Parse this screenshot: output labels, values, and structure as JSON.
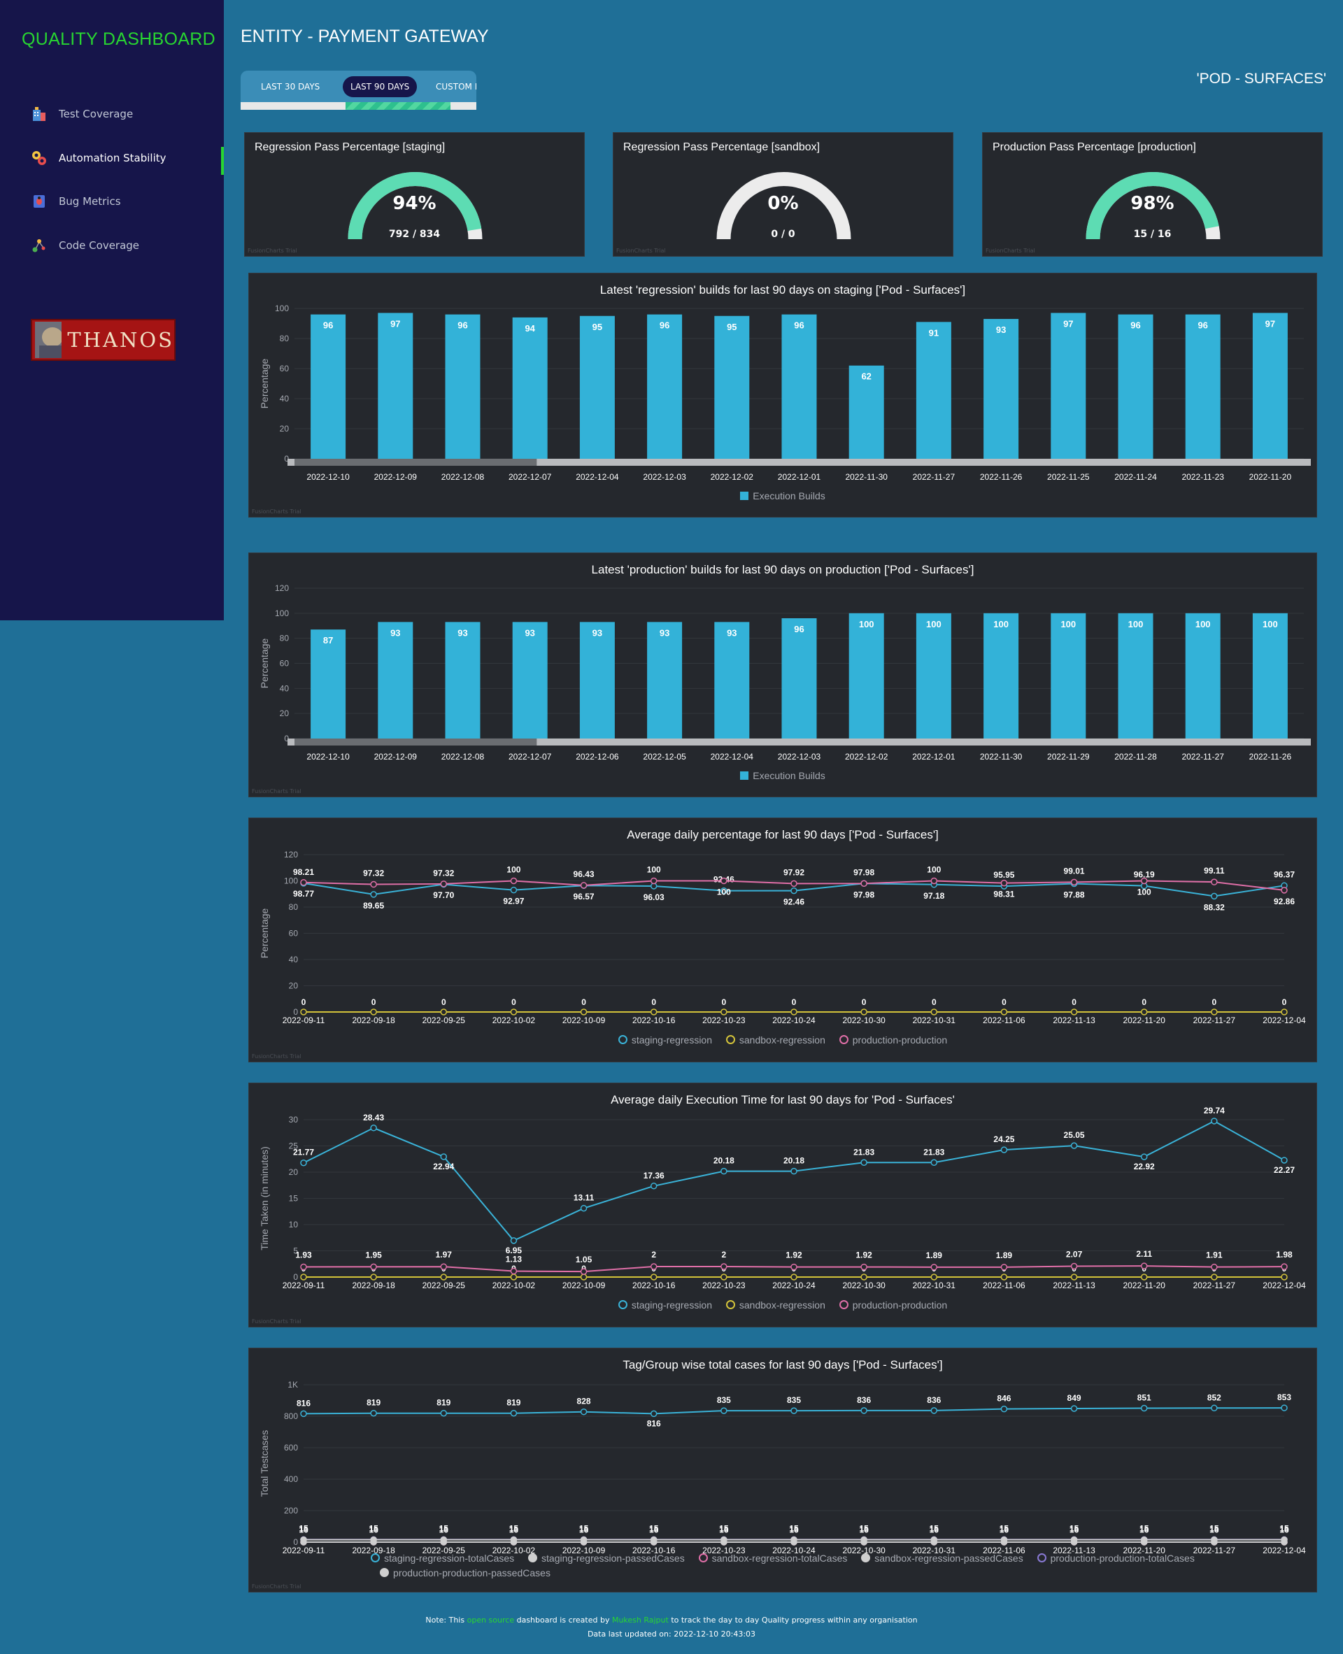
{
  "sidebar": {
    "app_title": "QUALITY DASHBOARD",
    "items": [
      {
        "label": "Test Coverage",
        "icon": "building-icon"
      },
      {
        "label": "Automation Stability",
        "icon": "gears-icon"
      },
      {
        "label": "Bug Metrics",
        "icon": "bug-icon"
      },
      {
        "label": "Code Coverage",
        "icon": "molecule-icon"
      }
    ],
    "active_index": 1,
    "logo_text": "THANOS"
  },
  "header": {
    "title": "ENTITY - PAYMENT GATEWAY",
    "pod_label": "'POD - SURFACES'",
    "tabs": [
      "LAST 30 DAYS",
      "LAST 90 DAYS",
      "CUSTOM DATE"
    ],
    "selected_tab": 1
  },
  "gauges": [
    {
      "title": "Regression Pass Percentage [staging]",
      "value": "94%",
      "sub": "792 / 834",
      "fraction": 0.9496,
      "trial": "FusionCharts Trial"
    },
    {
      "title": "Regression Pass Percentage [sandbox]",
      "value": "0%",
      "sub": "0 / 0",
      "fraction": 0,
      "trial": "FusionCharts Trial"
    },
    {
      "title": "Production Pass Percentage [production]",
      "value": "98%",
      "sub": "15 / 16",
      "fraction": 0.9375,
      "trial": "FusionCharts Trial"
    }
  ],
  "colors": {
    "bar": "#33b2d8",
    "staging": "#3ab3d8",
    "sandbox": "#d3c33a",
    "production": "#e06fa8",
    "gauge_fill": "#5ddcb3",
    "gauge_track": "#ececec",
    "green": "#28d631"
  },
  "chart_data": [
    {
      "type": "bar",
      "title": "Latest 'regression' builds for last 90 days on staging ['Pod - Surfaces']",
      "ylabel": "Percentage",
      "ylim": [
        0,
        100
      ],
      "yticks": [
        0,
        20,
        40,
        60,
        80,
        100
      ],
      "categories": [
        "2022-12-10",
        "2022-12-09",
        "2022-12-08",
        "2022-12-07",
        "2022-12-04",
        "2022-12-03",
        "2022-12-02",
        "2022-12-01",
        "2022-11-30",
        "2022-11-27",
        "2022-11-26",
        "2022-11-25",
        "2022-11-24",
        "2022-11-23",
        "2022-11-20"
      ],
      "series": [
        {
          "name": "Execution Builds",
          "values": [
            96,
            97,
            96,
            94,
            95,
            96,
            95,
            96,
            62,
            91,
            93,
            97,
            96,
            96,
            97
          ]
        }
      ],
      "trial": "FusionCharts Trial"
    },
    {
      "type": "bar",
      "title": "Latest 'production' builds for last 90 days on production ['Pod - Surfaces']",
      "ylabel": "Percentage",
      "ylim": [
        0,
        120
      ],
      "yticks": [
        0,
        20,
        40,
        60,
        80,
        100,
        120
      ],
      "categories": [
        "2022-12-10",
        "2022-12-09",
        "2022-12-08",
        "2022-12-07",
        "2022-12-06",
        "2022-12-05",
        "2022-12-04",
        "2022-12-03",
        "2022-12-02",
        "2022-12-01",
        "2022-11-30",
        "2022-11-29",
        "2022-11-28",
        "2022-11-27",
        "2022-11-26"
      ],
      "series": [
        {
          "name": "Execution Builds",
          "values": [
            87,
            93,
            93,
            93,
            93,
            93,
            93,
            96,
            100,
            100,
            100,
            100,
            100,
            100,
            100
          ]
        }
      ],
      "trial": "FusionCharts Trial"
    },
    {
      "type": "line",
      "title": "Average daily percentage for last 90 days ['Pod - Surfaces']",
      "ylabel": "Percentage",
      "ylim": [
        0,
        120
      ],
      "yticks": [
        0,
        20,
        40,
        60,
        80,
        100,
        120
      ],
      "categories": [
        "2022-09-11",
        "2022-09-18",
        "2022-09-25",
        "2022-10-02",
        "2022-10-09",
        "2022-10-16",
        "2022-10-23",
        "2022-10-24",
        "2022-10-30",
        "2022-10-31",
        "2022-11-06",
        "2022-11-13",
        "2022-11-20",
        "2022-11-27",
        "2022-12-04"
      ],
      "series": [
        {
          "name": "staging-regression",
          "color": "#3ab3d8",
          "values": [
            98.21,
            89.65,
            97.32,
            92.97,
            96.43,
            96.03,
            92.46,
            92.46,
            97.98,
            97.18,
            95.95,
            97.88,
            96.19,
            88.32,
            96.37
          ],
          "labels": [
            "98.21",
            "89.65",
            "97.32",
            "92.97",
            "96.43",
            "96.03",
            "92.46",
            "92.46",
            "97.98",
            "97.18",
            "95.95",
            "97.88",
            "96.19",
            "88.32",
            "96.37"
          ]
        },
        {
          "name": "sandbox-regression",
          "color": "#d3c33a",
          "values": [
            0,
            0,
            0,
            0,
            0,
            0,
            0,
            0,
            0,
            0,
            0,
            0,
            0,
            0,
            0
          ],
          "labels": [
            "0",
            "0",
            "0",
            "0",
            "0",
            "0",
            "0",
            "0",
            "0",
            "0",
            "0",
            "0",
            "0",
            "0",
            "0"
          ]
        },
        {
          "name": "production-production",
          "color": "#e06fa8",
          "values": [
            98.77,
            97.32,
            97.7,
            100,
            96.57,
            100,
            100,
            97.92,
            97.98,
            100,
            98.31,
            99.01,
            100,
            99.11,
            92.86
          ],
          "labels": [
            "98.77",
            "97.32",
            "97.70",
            "100",
            "96.57",
            "100",
            "100",
            "97.92",
            "97.98",
            "100",
            "98.31",
            "99.01",
            "100",
            "99.11",
            "92.86"
          ]
        }
      ],
      "trial": "FusionCharts Trial"
    },
    {
      "type": "line",
      "title": "Average daily Execution Time for last 90 days for 'Pod - Surfaces'",
      "ylabel": "Time Taken (in minutes)",
      "ylim": [
        0,
        30
      ],
      "yticks": [
        0,
        5,
        10,
        15,
        20,
        25,
        30
      ],
      "categories": [
        "2022-09-11",
        "2022-09-18",
        "2022-09-25",
        "2022-10-02",
        "2022-10-09",
        "2022-10-16",
        "2022-10-23",
        "2022-10-24",
        "2022-10-30",
        "2022-10-31",
        "2022-11-06",
        "2022-11-13",
        "2022-11-20",
        "2022-11-27",
        "2022-12-04"
      ],
      "series": [
        {
          "name": "staging-regression",
          "color": "#3ab3d8",
          "values": [
            21.77,
            28.43,
            22.94,
            6.95,
            13.11,
            17.36,
            20.18,
            20.18,
            21.83,
            21.83,
            24.25,
            25.05,
            22.92,
            29.74,
            22.27
          ],
          "labels": [
            "21.77",
            "28.43",
            "22.94",
            "6.95",
            "13.11",
            "17.36",
            "20.18",
            "20.18",
            "21.83",
            "21.83",
            "24.25",
            "25.05",
            "22.92",
            "29.74",
            "22.27"
          ]
        },
        {
          "name": "sandbox-regression",
          "color": "#d3c33a",
          "values": [
            0,
            0,
            0,
            0,
            0,
            0,
            0,
            0,
            0,
            0,
            0,
            0,
            0,
            0,
            0
          ],
          "labels": [
            "0",
            "0",
            "0",
            "0",
            "0",
            "0",
            "0",
            "0",
            "0",
            "0",
            "0",
            "0",
            "0",
            "0",
            "0"
          ]
        },
        {
          "name": "production-production",
          "color": "#e06fa8",
          "values": [
            1.93,
            1.95,
            1.97,
            1.13,
            1.05,
            2,
            2,
            1.92,
            1.92,
            1.89,
            1.89,
            2.07,
            2.11,
            1.91,
            1.98
          ],
          "labels": [
            "1.93",
            "1.95",
            "1.97",
            "1.13",
            "1.05",
            "2",
            "2",
            "1.92",
            "1.92",
            "1.89",
            "1.89",
            "2.07",
            "2.11",
            "1.91",
            "1.98"
          ]
        }
      ],
      "trial": "FusionCharts Trial"
    },
    {
      "type": "line",
      "title": "Tag/Group wise total cases for last 90 days ['Pod - Surfaces']",
      "ylabel": "Total Testcases",
      "ylim": [
        0,
        1000
      ],
      "yticks": [
        0,
        200,
        400,
        600,
        800,
        1000
      ],
      "ytick_labels": [
        "0",
        "200",
        "400",
        "600",
        "800",
        "1K"
      ],
      "categories": [
        "2022-09-11",
        "2022-09-18",
        "2022-09-25",
        "2022-10-02",
        "2022-10-09",
        "2022-10-16",
        "2022-10-23",
        "2022-10-24",
        "2022-10-30",
        "2022-10-31",
        "2022-11-06",
        "2022-11-13",
        "2022-11-20",
        "2022-11-27",
        "2022-12-04"
      ],
      "series": [
        {
          "name": "staging-regression-totalCases",
          "color": "#3ab3d8",
          "marker": "ring",
          "values": [
            816,
            819,
            819,
            819,
            828,
            816,
            835,
            835,
            836,
            836,
            846,
            849,
            851,
            852,
            853
          ],
          "labels": [
            "816",
            "819",
            "819",
            "819",
            "828",
            "816",
            "835",
            "835",
            "836",
            "836",
            "846",
            "849",
            "851",
            "852",
            "853"
          ]
        },
        {
          "name": "staging-regression-passedCases",
          "color": "#cfcfcf",
          "marker": "dot",
          "values": [
            0,
            0,
            0,
            0,
            0,
            0,
            0,
            0,
            0,
            0,
            0,
            0,
            0,
            0,
            0
          ]
        },
        {
          "name": "sandbox-regression-totalCases",
          "color": "#e06fa8",
          "marker": "ring",
          "values": [
            0,
            0,
            0,
            0,
            0,
            0,
            0,
            0,
            0,
            0,
            0,
            0,
            0,
            0,
            0
          ]
        },
        {
          "name": "sandbox-regression-passedCases",
          "color": "#cfcfcf",
          "marker": "dot",
          "values": [
            0,
            0,
            0,
            0,
            0,
            0,
            0,
            0,
            0,
            0,
            0,
            0,
            0,
            0,
            0
          ]
        },
        {
          "name": "production-production-totalCases",
          "color": "#8a7ad6",
          "marker": "ring",
          "values": [
            16,
            16,
            16,
            16,
            16,
            16,
            16,
            16,
            16,
            16,
            16,
            16,
            16,
            16,
            16
          ],
          "labels": [
            "16",
            "16",
            "16",
            "16",
            "16",
            "16",
            "16",
            "16",
            "16",
            "16",
            "16",
            "16",
            "16",
            "16",
            "16"
          ]
        },
        {
          "name": "production-production-passedCases",
          "color": "#cfcfcf",
          "marker": "dot",
          "values": [
            15,
            15,
            15,
            15,
            15,
            15,
            15,
            15,
            15,
            15,
            15,
            15,
            15,
            15,
            15
          ],
          "labels": [
            "15",
            "15",
            "15",
            "15",
            "15",
            "15",
            "15",
            "15",
            "15",
            "15",
            "15",
            "15",
            "15",
            "15",
            "15"
          ]
        }
      ],
      "trial": "FusionCharts Trial"
    }
  ],
  "footer": {
    "note_prefix": "Note: This",
    "open_source": "open source",
    "note_mid": "dashboard is created by",
    "author": "Mukesh Rajput",
    "note_suffix": "to track the day to day Quality progress within any organisation",
    "updated": "Data last updated on: 2022-12-10 20:43:03"
  }
}
